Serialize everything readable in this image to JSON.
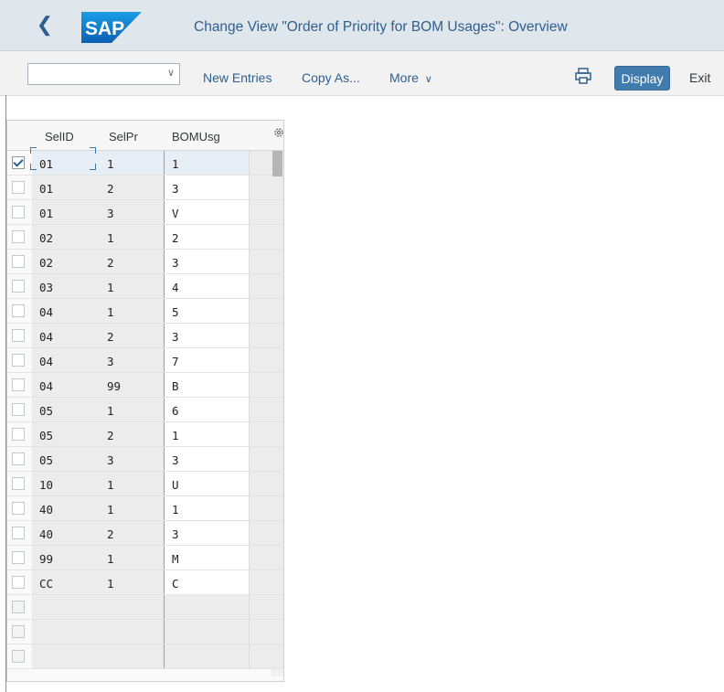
{
  "window": {
    "title": "Change View \"Order of Priority for BOM Usages\": Overview",
    "logo_text": "SAP"
  },
  "toolbar": {
    "command_value": "",
    "new_entries": "New Entries",
    "copy_as": "Copy As...",
    "more": "More",
    "display": "Display",
    "exit": "Exit"
  },
  "table": {
    "headers": [
      "SelID",
      "SelPr",
      "BOMUsg"
    ],
    "rows": [
      {
        "selid": "01",
        "selpr": "1",
        "bomusg": "1",
        "checked": true
      },
      {
        "selid": "01",
        "selpr": "2",
        "bomusg": "3",
        "checked": false
      },
      {
        "selid": "01",
        "selpr": "3",
        "bomusg": "V",
        "checked": false
      },
      {
        "selid": "02",
        "selpr": "1",
        "bomusg": "2",
        "checked": false
      },
      {
        "selid": "02",
        "selpr": "2",
        "bomusg": "3",
        "checked": false
      },
      {
        "selid": "03",
        "selpr": "1",
        "bomusg": "4",
        "checked": false
      },
      {
        "selid": "04",
        "selpr": "1",
        "bomusg": "5",
        "checked": false
      },
      {
        "selid": "04",
        "selpr": "2",
        "bomusg": "3",
        "checked": false
      },
      {
        "selid": "04",
        "selpr": "3",
        "bomusg": "7",
        "checked": false
      },
      {
        "selid": "04",
        "selpr": "99",
        "bomusg": "B",
        "checked": false
      },
      {
        "selid": "05",
        "selpr": "1",
        "bomusg": "6",
        "checked": false
      },
      {
        "selid": "05",
        "selpr": "2",
        "bomusg": "1",
        "checked": false
      },
      {
        "selid": "05",
        "selpr": "3",
        "bomusg": "3",
        "checked": false
      },
      {
        "selid": "10",
        "selpr": "1",
        "bomusg": "U",
        "checked": false
      },
      {
        "selid": "40",
        "selpr": "1",
        "bomusg": "1",
        "checked": false
      },
      {
        "selid": "40",
        "selpr": "2",
        "bomusg": "3",
        "checked": false
      },
      {
        "selid": "99",
        "selpr": "1",
        "bomusg": "M",
        "checked": false
      },
      {
        "selid": "CC",
        "selpr": "1",
        "bomusg": "C",
        "checked": false
      }
    ],
    "empty_rows": 3
  },
  "colors": {
    "accent": "#427cac",
    "titlebar": "#dfe6ec",
    "title_text": "#2f5f8f"
  }
}
